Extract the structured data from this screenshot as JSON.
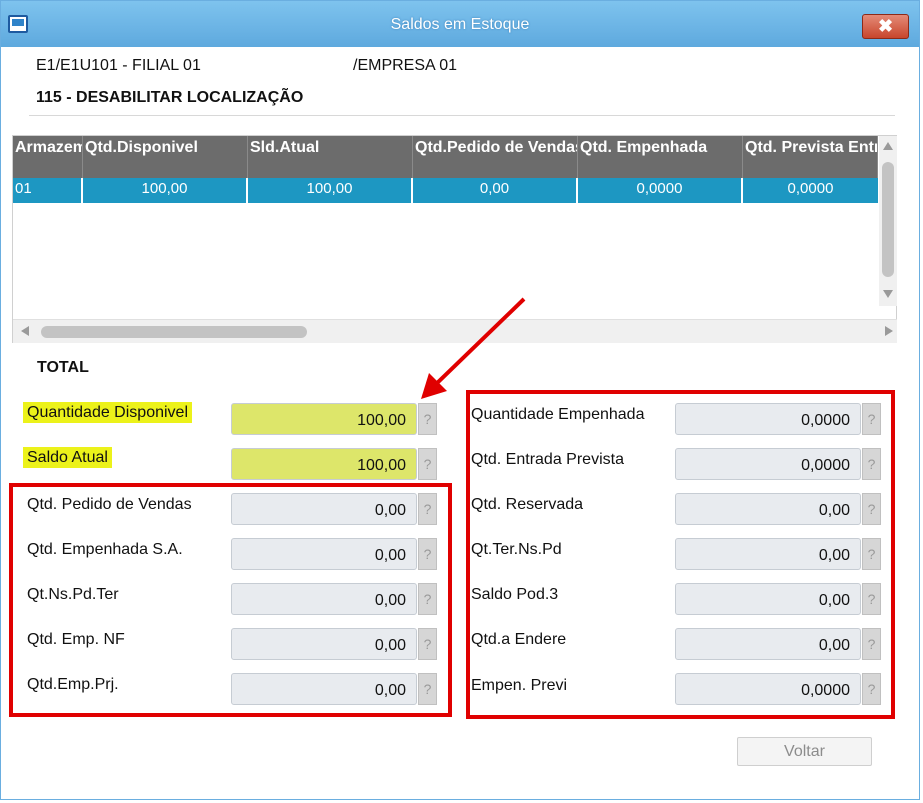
{
  "window": {
    "title": "Saldos em Estoque",
    "close_glyph": "✖"
  },
  "header": {
    "filial": "E1/E1U101 - FILIAL 01",
    "empresa": "/EMPRESA 01",
    "produto": "115 - DESABILITAR LOCALIZAÇÃO"
  },
  "grid": {
    "columns": [
      "Armazem",
      "Qtd.Disponivel",
      "Sld.Atual",
      "Qtd.Pedido de Vendas",
      "Qtd. Empenhada",
      "Qtd. Prevista Entr."
    ],
    "rows": [
      [
        "01",
        "100,00",
        "100,00",
        "0,00",
        "0,0000",
        "0,0000"
      ]
    ]
  },
  "total": {
    "title": "TOTAL",
    "left": [
      {
        "label": "Quantidade Disponivel",
        "value": "100,00"
      },
      {
        "label": "Saldo Atual",
        "value": "100,00"
      },
      {
        "label": "Qtd. Pedido de Vendas",
        "value": "0,00"
      },
      {
        "label": "Qtd. Empenhada S.A.",
        "value": "0,00"
      },
      {
        "label": "Qt.Ns.Pd.Ter",
        "value": "0,00"
      },
      {
        "label": "Qtd. Emp. NF",
        "value": "0,00"
      },
      {
        "label": "Qtd.Emp.Prj.",
        "value": "0,00"
      }
    ],
    "right": [
      {
        "label": "Quantidade Empenhada",
        "value": "0,0000"
      },
      {
        "label": "Qtd. Entrada Prevista",
        "value": "0,0000"
      },
      {
        "label": "Qtd. Reservada",
        "value": "0,00"
      },
      {
        "label": "Qt.Ter.Ns.Pd",
        "value": "0,00"
      },
      {
        "label": "Saldo Pod.3",
        "value": "0,00"
      },
      {
        "label": "Qtd.a Endere",
        "value": "0,00"
      },
      {
        "label": "Empen. Previ",
        "value": "0,0000"
      }
    ],
    "help_glyph": "?"
  },
  "footer": {
    "voltar_label": "Voltar"
  },
  "colors": {
    "titlebar": "#5ea9de",
    "grid_header": "#6c6c6c",
    "selected_row": "#1d97c2",
    "highlight": "#ecf21a",
    "annotation_red": "#e00000"
  }
}
